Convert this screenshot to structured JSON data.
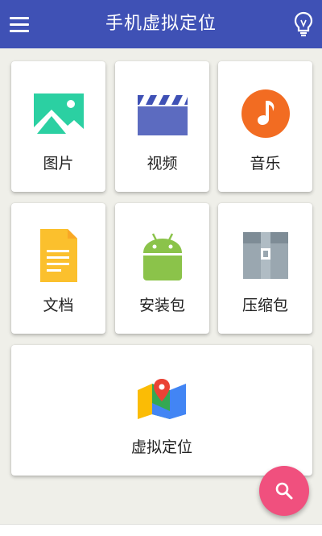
{
  "app_bar": {
    "title": "手机虚拟定位",
    "menu_icon": "hamburger-menu-icon",
    "tip_icon": "lightbulb-icon",
    "background": "#3f51b5"
  },
  "categories": [
    {
      "label": "图片",
      "icon": "image-icon",
      "color": "#2bd0a2"
    },
    {
      "label": "视频",
      "icon": "clapperboard-icon",
      "color": "#5c6bc0"
    },
    {
      "label": "音乐",
      "icon": "music-note-icon",
      "color": "#f26c22"
    },
    {
      "label": "文档",
      "icon": "document-icon",
      "color": "#fbc02d"
    },
    {
      "label": "安装包",
      "icon": "android-icon",
      "color": "#8bc34a"
    },
    {
      "label": "压缩包",
      "icon": "archive-box-icon",
      "color": "#9aa7b0"
    }
  ],
  "feature": {
    "label": "虚拟定位",
    "icon": "map-pin-icon"
  },
  "fab": {
    "icon": "search-icon",
    "color": "#f0507e"
  }
}
